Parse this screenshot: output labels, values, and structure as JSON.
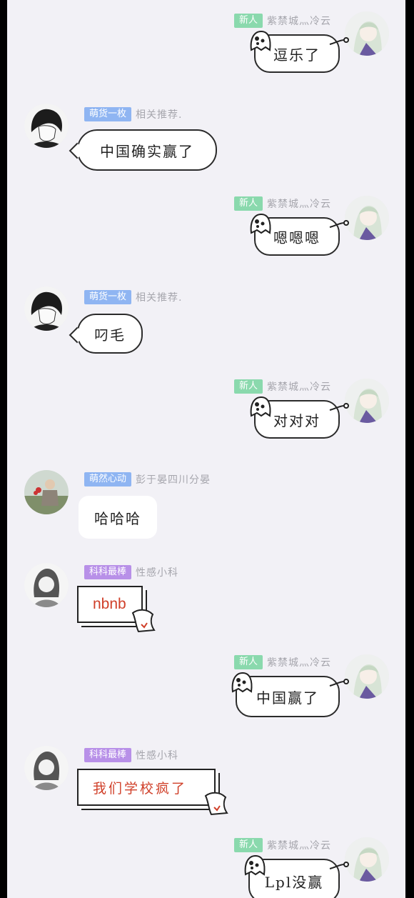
{
  "messages": [
    {
      "side": "right",
      "badge": "新人",
      "badge_color": "green",
      "nick": "紫禁城灬冷云",
      "text": "逗乐了",
      "bubble": "ghost",
      "avatar_icon": "anime-girl-avatar"
    },
    {
      "side": "left",
      "badge": "萌货一枚",
      "badge_color": "blue",
      "nick": "相关推荐.",
      "text": "中国确实赢了",
      "bubble": "outline",
      "avatar_icon": "anime-boy-avatar"
    },
    {
      "side": "right",
      "badge": "新人",
      "badge_color": "green",
      "nick": "紫禁城灬冷云",
      "text": "嗯嗯嗯",
      "bubble": "ghost",
      "avatar_icon": "anime-girl-avatar"
    },
    {
      "side": "left",
      "badge": "萌货一枚",
      "badge_color": "blue",
      "nick": "相关推荐.",
      "text": "叼毛",
      "bubble": "outline",
      "avatar_icon": "anime-boy-avatar"
    },
    {
      "side": "right",
      "badge": "新人",
      "badge_color": "green",
      "nick": "紫禁城灬冷云",
      "text": "对对对",
      "bubble": "ghost",
      "avatar_icon": "anime-girl-avatar"
    },
    {
      "side": "left",
      "badge": "萌然心动",
      "badge_color": "blue",
      "nick": "彭于晏四川分晏",
      "text": "哈哈哈",
      "bubble": "plain",
      "avatar_icon": "photo-person-avatar"
    },
    {
      "side": "left",
      "badge": "科科最棒",
      "badge_color": "purple",
      "nick": "性感小科",
      "text": "nbnb",
      "bubble": "note",
      "avatar_icon": "sketch-girl-avatar"
    },
    {
      "side": "right",
      "badge": "新人",
      "badge_color": "green",
      "nick": "紫禁城灬冷云",
      "text": "中国赢了",
      "bubble": "ghost",
      "avatar_icon": "anime-girl-avatar"
    },
    {
      "side": "left",
      "badge": "科科最棒",
      "badge_color": "purple",
      "nick": "性感小科",
      "text": "我们学校疯了",
      "bubble": "note-serif",
      "avatar_icon": "sketch-girl-avatar"
    },
    {
      "side": "right",
      "badge": "新人",
      "badge_color": "green",
      "nick": "紫禁城灬冷云",
      "text": "Lpl没赢",
      "bubble": "ghost",
      "avatar_icon": "anime-girl-avatar"
    }
  ],
  "colors": {
    "background": "#f2f1f6",
    "badge_green": "#8ad9ad",
    "badge_blue": "#8fb5f2",
    "badge_purple": "#b890e8",
    "note_text": "#d0402a"
  }
}
